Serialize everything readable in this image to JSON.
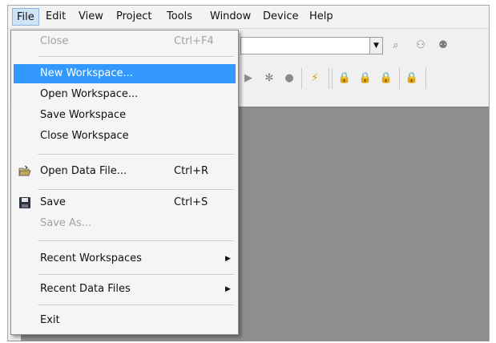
{
  "menubar": {
    "items": [
      "File",
      "Edit",
      "View",
      "Project",
      "Tools",
      "Window",
      "Device",
      "Help"
    ]
  },
  "file_menu": {
    "close": {
      "label": "Close",
      "shortcut": "Ctrl+F4"
    },
    "new_workspace": {
      "label": "New Workspace..."
    },
    "open_workspace": {
      "label": "Open Workspace..."
    },
    "save_workspace": {
      "label": "Save Workspace"
    },
    "close_workspace": {
      "label": "Close Workspace"
    },
    "open_data_file": {
      "label": "Open Data File...",
      "shortcut": "Ctrl+R",
      "icon": "open-folder-icon"
    },
    "save": {
      "label": "Save",
      "shortcut": "Ctrl+S",
      "icon": "floppy-disk-icon"
    },
    "save_as": {
      "label": "Save As..."
    },
    "recent_workspaces": {
      "label": "Recent Workspaces"
    },
    "recent_data_files": {
      "label": "Recent Data Files"
    },
    "exit": {
      "label": "Exit"
    }
  },
  "colors": {
    "highlight": "#3399ff",
    "workspace_bg": "#8e8e8e",
    "menubar_active": "#cfe3f7"
  }
}
